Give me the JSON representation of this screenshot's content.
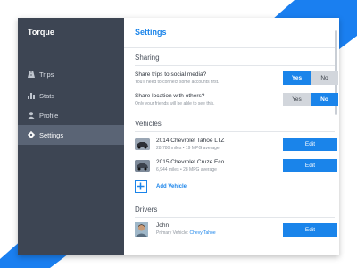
{
  "app": {
    "title": "Torque"
  },
  "sidebar": {
    "items": [
      {
        "label": "Trips",
        "icon": "road-icon",
        "active": false
      },
      {
        "label": "Stats",
        "icon": "bar-chart-icon",
        "active": false
      },
      {
        "label": "Profile",
        "icon": "person-icon",
        "active": false
      },
      {
        "label": "Settings",
        "icon": "gear-icon",
        "active": true
      }
    ]
  },
  "main": {
    "title": "Settings",
    "sharing": {
      "heading": "Sharing",
      "options": [
        {
          "title": "Share trips to social media?",
          "subtitle": "You'll need to connect some accounts first.",
          "yes": "Yes",
          "no": "No",
          "selected": "yes"
        },
        {
          "title": "Share location with others?",
          "subtitle": "Only your friends will be able to see this.",
          "yes": "Yes",
          "no": "No",
          "selected": "no"
        }
      ]
    },
    "vehicles": {
      "heading": "Vehicles",
      "items": [
        {
          "name": "2014 Chevrolet Tahoe LTZ",
          "meta": "28,780 miles • 19 MPG average",
          "edit": "Edit"
        },
        {
          "name": "2015 Chevrolet Cruze Eco",
          "meta": "6,944 miles • 28 MPG average",
          "edit": "Edit"
        }
      ],
      "add_label": "Add Vehicle"
    },
    "drivers": {
      "heading": "Drivers",
      "items": [
        {
          "name": "John",
          "subtitle_prefix": "Primary Vehicle:",
          "subtitle_vehicle": "Chevy Tahoe",
          "edit": "Edit"
        }
      ]
    }
  },
  "colors": {
    "accent": "#1a84ea",
    "sidebar": "#3d4553",
    "sidebar_active": "#5a6475",
    "background_triangle": "#1a7ff0"
  }
}
